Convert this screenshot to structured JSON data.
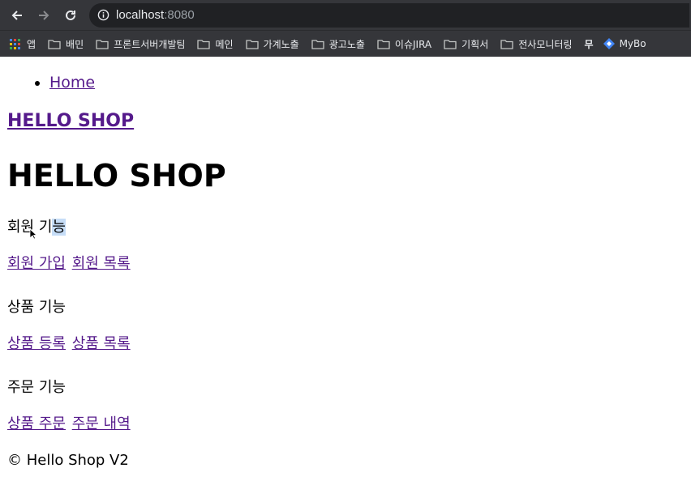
{
  "browser": {
    "url_host": "localhost",
    "url_port": ":8080",
    "bookmarks": [
      "앱",
      "배민",
      "프론트서버개발팀",
      "메인",
      "가계노출",
      "광고노출",
      "이슈JIRA",
      "기획서",
      "전사모니터링",
      "무",
      "MyBo"
    ]
  },
  "nav": {
    "home_label": "Home"
  },
  "site_link": "HELLO SHOP",
  "site_title": "HELLO SHOP",
  "sections": {
    "member": {
      "label_a": "회원 기",
      "label_b": "능",
      "link1": "회원 가입",
      "link2": "회원 목록"
    },
    "item": {
      "label": "상품 기능",
      "link1": "상품 등록",
      "link2": "상품 목록"
    },
    "order": {
      "label": "주문 기능",
      "link1": "상품 주문",
      "link2": "주문 내역"
    }
  },
  "footer": "© Hello Shop V2",
  "colors": {
    "toolbar_bg": "#35363a",
    "omnibox_bg": "#202124",
    "link_visited": "#551a8b",
    "selection": "#c6ddf7",
    "bookmark_accent": "#4285f4"
  }
}
